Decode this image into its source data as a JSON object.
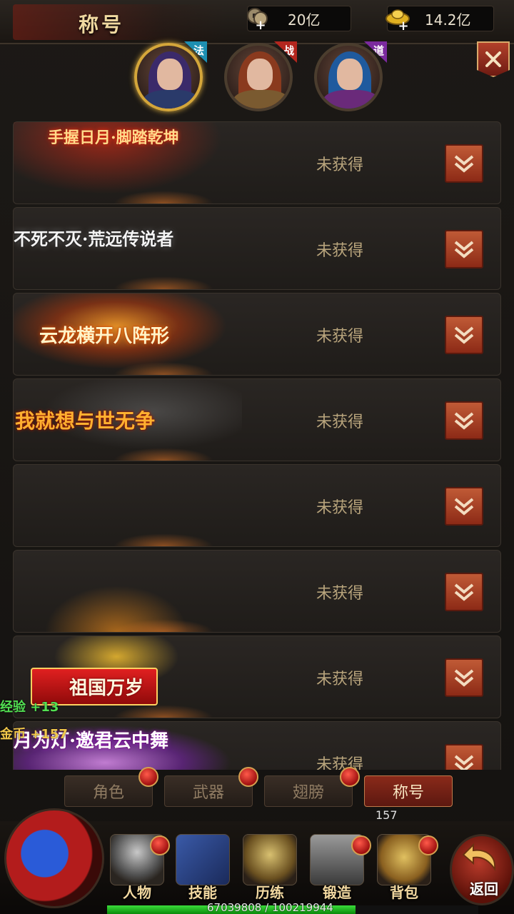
{
  "header": {
    "title": "称号",
    "currency1": {
      "icon": "coin-icon",
      "value": "20亿"
    },
    "currency2": {
      "icon": "gold-ingot-icon",
      "value": "14.2亿"
    }
  },
  "classes": [
    {
      "tag": "法",
      "active": true,
      "flag_color": "#1d8fb2"
    },
    {
      "tag": "战",
      "active": false,
      "flag_color": "#b3261e"
    },
    {
      "tag": "道",
      "active": false,
      "flag_color": "#7b2a9e"
    }
  ],
  "titles": [
    {
      "name": "手握日月·脚踏乾坤",
      "status": "未获得"
    },
    {
      "name": "不死不灭·荒远传说者",
      "status": "未获得"
    },
    {
      "name": "云龙横开八阵形",
      "status": "未获得"
    },
    {
      "name": "我就想与世无争",
      "status": "未获得"
    },
    {
      "name": "",
      "status": "未获得"
    },
    {
      "name": "",
      "status": "未获得"
    },
    {
      "name": "祖国万岁",
      "status": "未获得"
    },
    {
      "name": "月为灯·邀君云中舞",
      "status": "未获得"
    }
  ],
  "floating": {
    "exp": "经验 +13",
    "gold": "金币 +157"
  },
  "tabs": [
    {
      "label": "角色"
    },
    {
      "label": "武器"
    },
    {
      "label": "翅膀"
    },
    {
      "label": "称号"
    }
  ],
  "count": "157",
  "nav": [
    {
      "label": "人物",
      "icon": "helmet-icon"
    },
    {
      "label": "技能",
      "icon": "skill-book-icon"
    },
    {
      "label": "历练",
      "icon": "armor-icon"
    },
    {
      "label": "锻造",
      "icon": "anvil-icon"
    },
    {
      "label": "背包",
      "icon": "bag-icon"
    }
  ],
  "back_label": "返回",
  "exp": {
    "text": "67039808 / 100219944",
    "fraction": 0.669
  }
}
